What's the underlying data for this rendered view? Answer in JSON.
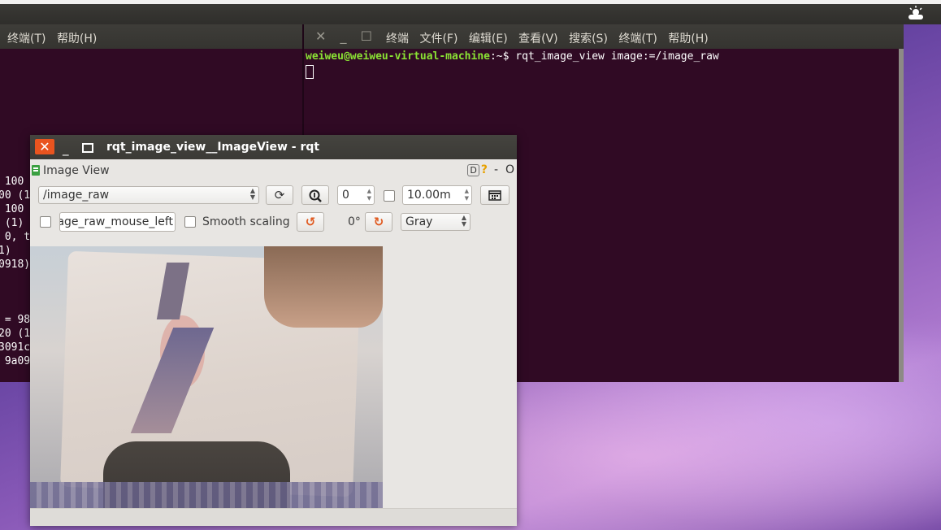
{
  "top_bar": {
    "tray_icon": "weather-cloud-icon"
  },
  "terminal_left": {
    "menus": [
      "终端(T)",
      "帮助(H)"
    ],
    "lines": [
      " 100",
      "00 (1",
      " 100",
      " (1)",
      " 0, t",
      "1)",
      "0918)",
      "",
      "",
      " = 98",
      "20 (1",
      "3091c",
      " 9a09"
    ]
  },
  "terminal_right": {
    "menus": [
      "终端",
      "文件(F)",
      "编辑(E)",
      "查看(V)",
      "搜索(S)",
      "终端(T)",
      "帮助(H)"
    ],
    "prompt_user": "weiweu@weiweu-virtual-machine",
    "prompt_suffix": ":~$ ",
    "command": "rqt_image_view image:=/image_raw"
  },
  "rqt": {
    "title": "rqt_image_view__ImageView - rqt",
    "dock_title": "Image View",
    "dock_buttons": {
      "d": "D",
      "help": "?",
      "minimize": "-",
      "close": "O"
    },
    "topic": "/image_raw",
    "spin_value": "0",
    "period": "10.00m",
    "mouse_topic": "age_raw_mouse_left",
    "smooth_label": "Smooth scaling",
    "rotation": "0°",
    "color_mode": "Gray",
    "smooth_checked": false,
    "mouse_checked": false,
    "dynamic_checked": false
  }
}
